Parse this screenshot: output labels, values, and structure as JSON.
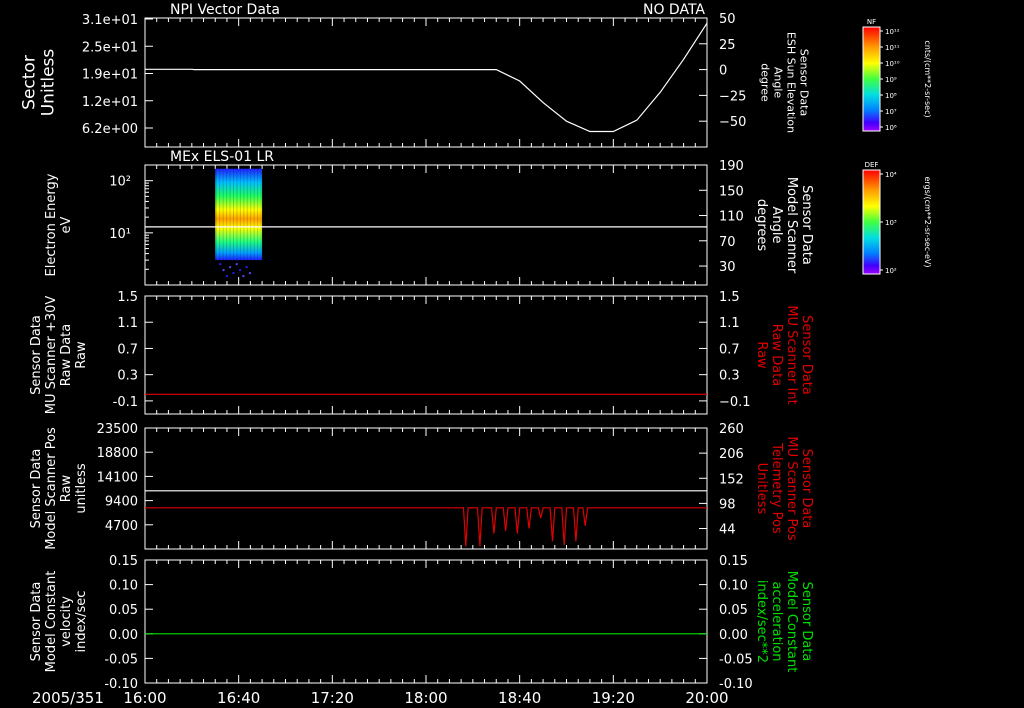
{
  "date_label": "2005/351",
  "time_ticks": [
    "16:00",
    "16:40",
    "17:20",
    "18:00",
    "18:40",
    "19:20",
    "20:00"
  ],
  "colors": {
    "background": "#000000",
    "axes": "#ffffff",
    "red_series": "#e00000",
    "green_series": "#00e000"
  },
  "colorbars": [
    {
      "title": "NF",
      "unit": "cnts/(cm**2-sr-sec)",
      "ticks": [
        "10¹²",
        "10¹¹",
        "10¹⁰",
        "10⁹",
        "10⁸",
        "10⁷",
        "10⁶"
      ]
    },
    {
      "title": "DEF",
      "unit": "ergs/(cm**2-sr-sec-eV)",
      "ticks": [
        "10⁴",
        "10³",
        "10²"
      ]
    }
  ],
  "chart_data": [
    {
      "type": "line",
      "title": "NPI Vector Data",
      "status": "NO DATA",
      "ylabel": [
        "Sector",
        "Unitless"
      ],
      "yticks": [
        "3.1e+01",
        "2.5e+01",
        "1.9e+01",
        "1.2e+01",
        "6.2e+00"
      ],
      "y2label": [
        "Sensor Data",
        "ESH Sun Elevation",
        "Angle",
        "degree"
      ],
      "y2lim": [
        -75,
        50
      ],
      "y2ticks": [
        50,
        25,
        0,
        -25,
        -50
      ],
      "series": [
        {
          "color": "#ffffff",
          "axis": "right",
          "x": [
            "16:00",
            "16:20",
            "16:21",
            "17:00",
            "18:30",
            "18:40",
            "18:50",
            "19:00",
            "19:10",
            "19:20",
            "19:30",
            "19:40",
            "19:50",
            "20:00"
          ],
          "y": [
            0.3,
            0.3,
            0,
            0,
            0,
            -11,
            -32,
            -50,
            -60,
            -60,
            -49,
            -22,
            10,
            45
          ]
        }
      ]
    },
    {
      "type": "heatmap",
      "title": "MEx ELS-01 LR",
      "ylabel": [
        "Electron Energy",
        "eV"
      ],
      "yscale": "log",
      "ylim": [
        1,
        200
      ],
      "yticks": [
        "10²",
        "10¹"
      ],
      "y2label": [
        "Sensor Data",
        "Model Scanner",
        "Angle",
        "degrees"
      ],
      "y2lim": [
        0,
        190
      ],
      "y2ticks": [
        190,
        150,
        110,
        70,
        30
      ],
      "data_span": {
        "x": [
          "16:30",
          "16:50"
        ],
        "energy": [
          3,
          170
        ]
      },
      "series": [
        {
          "color": "#ffffff",
          "axis": "right",
          "x": [
            "16:00",
            "20:00"
          ],
          "y": [
            92,
            92
          ]
        }
      ]
    },
    {
      "type": "line",
      "ylabel": [
        "Sensor Data",
        "MU Scanner +30V",
        "Raw Data",
        "Raw"
      ],
      "ylim": [
        -0.3,
        1.5
      ],
      "yticks": [
        1.5,
        1.1,
        0.7,
        0.3,
        -0.1
      ],
      "y2label": [
        "Sensor Data",
        "MU Scanner Int",
        "Raw Data",
        "Raw"
      ],
      "y2lim": [
        -0.3,
        1.5
      ],
      "y2ticks": [
        1.5,
        1.1,
        0.7,
        0.3,
        -0.1
      ],
      "series": [
        {
          "color": "#e00000",
          "axis": "left",
          "x": [
            "16:00",
            "20:00"
          ],
          "y": [
            0,
            0
          ]
        }
      ]
    },
    {
      "type": "line",
      "ylabel": [
        "Sensor Data",
        "Model Scanner Pos",
        "Raw",
        "unitless"
      ],
      "ylim": [
        0,
        23500
      ],
      "yticks": [
        23500,
        18800,
        14100,
        9400,
        4700
      ],
      "y2label": [
        "Sensor Data",
        "MU Scanner Pos",
        "Telemetry Pos",
        "Unitless"
      ],
      "y2lim": [
        0,
        260
      ],
      "y2ticks": [
        260,
        206,
        152,
        98,
        44
      ],
      "series": [
        {
          "color": "#ffffff",
          "axis": "left",
          "x": [
            "16:00",
            "20:00"
          ],
          "y": [
            11300,
            11300
          ]
        },
        {
          "color": "#e00000",
          "axis": "left",
          "x": [
            "16:00",
            "18:16",
            "18:17",
            "18:18",
            "18:22",
            "18:23",
            "18:24",
            "18:28",
            "18:29",
            "18:30",
            "18:33",
            "18:34",
            "18:35",
            "18:38",
            "18:39",
            "18:40",
            "18:43",
            "18:44",
            "18:45",
            "18:48",
            "18:49",
            "18:50",
            "18:53",
            "18:54",
            "18:55",
            "18:58",
            "18:59",
            "19:00",
            "19:03",
            "19:04",
            "19:05",
            "19:07",
            "19:08",
            "19:09",
            "20:00"
          ],
          "y": [
            8000,
            8000,
            500,
            8000,
            8000,
            500,
            8000,
            8000,
            3000,
            8000,
            8000,
            3500,
            8000,
            8000,
            3000,
            8000,
            8000,
            4000,
            8000,
            8000,
            6000,
            8000,
            8000,
            1500,
            8000,
            8000,
            800,
            8000,
            8000,
            1500,
            8000,
            8000,
            4500,
            8000,
            8000
          ]
        }
      ]
    },
    {
      "type": "line",
      "ylabel": [
        "Sensor Data",
        "Model Constant",
        "velocity",
        "index/sec"
      ],
      "ylim": [
        -0.1,
        0.15
      ],
      "yticks": [
        "0.15",
        "0.10",
        "0.05",
        "0.00",
        "-0.05",
        "-0.10"
      ],
      "y2label": [
        "Sensor Data",
        "Model Constant",
        "acceleration",
        "index/sec**2"
      ],
      "y2lim": [
        -0.1,
        0.15
      ],
      "y2ticks": [
        "0.15",
        "0.10",
        "0.05",
        "0.00",
        "-0.05",
        "-0.10"
      ],
      "series": [
        {
          "color": "#00e000",
          "axis": "left",
          "x": [
            "16:00",
            "20:00"
          ],
          "y": [
            0,
            0
          ]
        }
      ]
    }
  ]
}
